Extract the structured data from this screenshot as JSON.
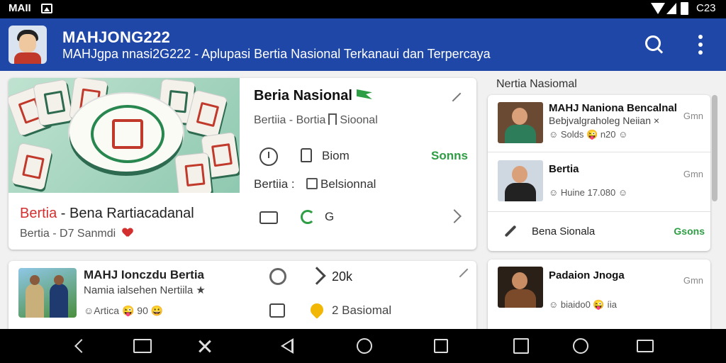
{
  "status_bar": {
    "carrier": "MAII",
    "time": "C23"
  },
  "app_bar": {
    "title": "MAHJONG222",
    "subtitle": "MAHJgpa nnasi2G222 - Aplupasi Bertia Nasional Terkanaui dan Terpercaya"
  },
  "featured": {
    "title_red": "Bertia",
    "title_rest": " - Bena Rartiacadanal",
    "meta": "Bertia - D7 Sanmdi",
    "detail": {
      "heading": "Beria Nasional",
      "sub": "Bertiia - Bortia",
      "sub_tag": "Sioonal",
      "row1_label": "Biom",
      "row1_value": "Sonns",
      "row2_label": "Bertiia :",
      "row2_value": "Belsionnal",
      "row3_value": "G"
    }
  },
  "small_card": {
    "title": "MAHJ Ionczdu Bertia",
    "subtitle": "Namia ialsehen Nertiila ★",
    "meta": "☺Artica 😜 90 😀",
    "right_row1": "20k",
    "right_row2": "2 Basiomal"
  },
  "side": {
    "heading": "Nertia Nasiomal",
    "items": [
      {
        "title": "MAHJ Naniona Bencalnal",
        "subtitle": "Bebjvalgraholeg Neiian ×",
        "meta": "☺ Solds 😜 n20 ☺",
        "dots": "Gmn"
      },
      {
        "title": "Bertia",
        "subtitle": "",
        "meta": "☺ Huine 17.080 ☺",
        "dots": "Gmn"
      },
      {
        "title": "Bena Sionala",
        "value": "Gsons"
      },
      {
        "title": "Padaion Jnoga",
        "subtitle": "",
        "meta": "☺ biaido0 😜 íia",
        "dots": "Gmn"
      }
    ]
  },
  "colors": {
    "app_bar": "#1f47a8",
    "accent_green": "#2e9e44",
    "accent_red": "#d32f2f"
  }
}
